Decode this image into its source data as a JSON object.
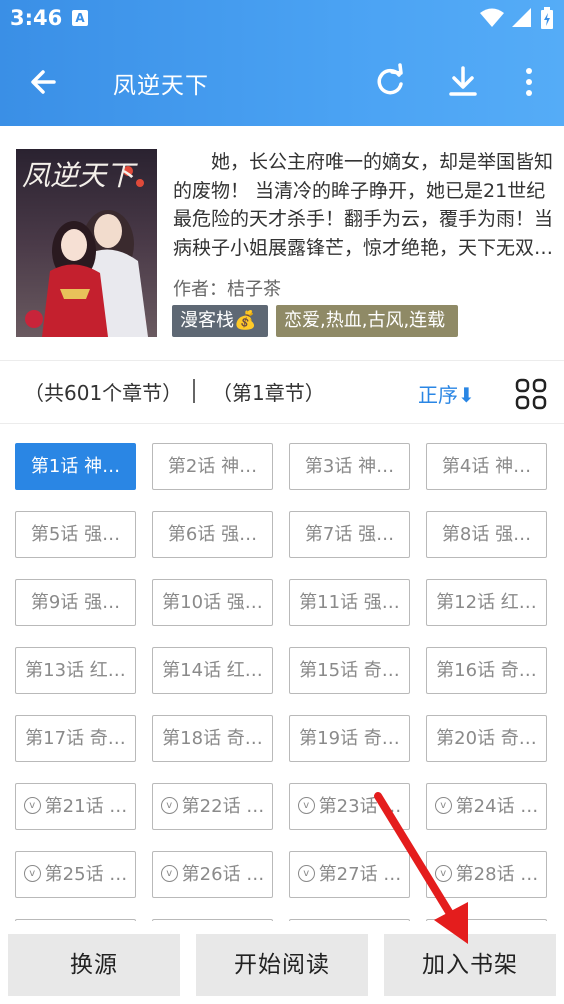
{
  "status": {
    "time": "3:46",
    "notification": "A"
  },
  "appbar": {
    "title": "凤逆天下"
  },
  "book": {
    "description": "她，长公主府唯一的嫡女，却是举国皆知的废物！ 当清冷的眸子睁开，她已是21世纪最危险的天才杀手！翻手为云，覆手为雨！当病秧子小姐展露锋芒，惊才绝艳，天下无双…",
    "author_line": "作者：桔子茶",
    "source_tag": "漫客栈💰",
    "genre_tag": "恋爱,热血,古风,连载",
    "cover_title": "凤逆天下"
  },
  "chapter_bar": {
    "total": "（共601个章节）",
    "current": "（第1章节）",
    "sort_label": "正序⬇"
  },
  "chapters": [
    "第1话 神…",
    "第2话 神…",
    "第3话 神…",
    "第4话 神…",
    "第5话 强…",
    "第6话 强…",
    "第7话 强…",
    "第8话 强…",
    "第9话 强…",
    "第10话 强…",
    "第11话 强…",
    "第12话 红…",
    "第13话 红…",
    "第14话 红…",
    "第15话 奇…",
    "第16话 奇…",
    "第17话 奇…",
    "第18话 奇…",
    "第19话 奇…",
    "第20话 奇…",
    "第21话 …",
    "第22话 …",
    "第23话 …",
    "第24话 …",
    "第25话 …",
    "第26话 …",
    "第27话 …",
    "第28话 …",
    "",
    "",
    "",
    ""
  ],
  "active_chapter_index": 0,
  "vip_from_index": 20,
  "vip_glyph": "v",
  "bottom": {
    "switch_source": "换源",
    "start_reading": "开始阅读",
    "add_shelf": "加入书架"
  },
  "colors": {
    "accent": "#2a86e4",
    "annotation": "#e41d1d"
  }
}
